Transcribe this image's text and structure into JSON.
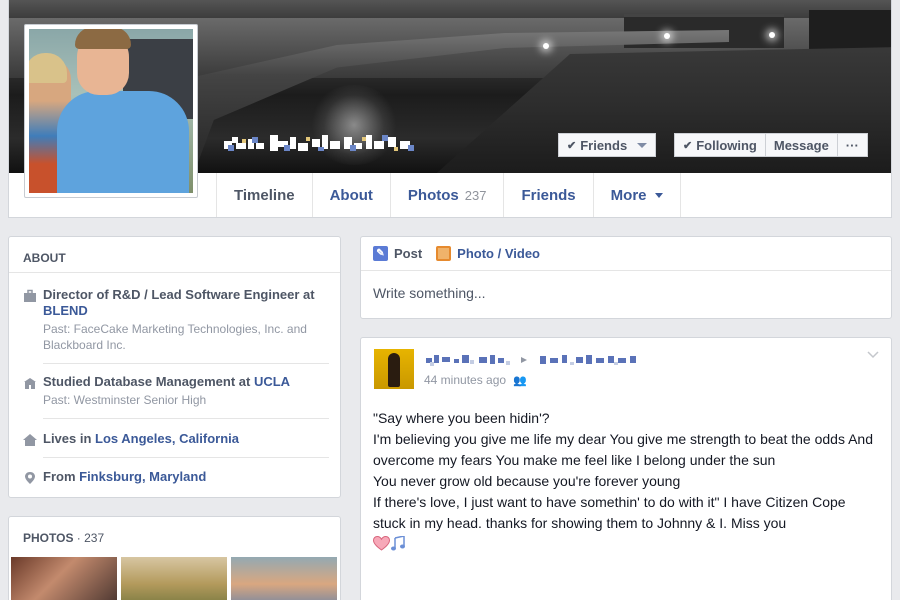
{
  "colors": {
    "link": "#3b5998",
    "muted": "#9197a3",
    "text": "#4e5665",
    "bg": "#e9eaed"
  },
  "profile": {
    "relationship_buttons": [
      {
        "label": "Friends",
        "icon": "check-icon",
        "has_caret": true
      },
      {
        "label": "Following",
        "icon": "check-icon",
        "has_caret": false
      },
      {
        "label": "Message",
        "icon": "",
        "has_caret": false
      },
      {
        "label": "···",
        "icon": "more-icon",
        "has_caret": false
      }
    ]
  },
  "tabs": [
    {
      "label": "Timeline",
      "count": "",
      "active": true
    },
    {
      "label": "About",
      "count": "",
      "active": false
    },
    {
      "label": "Photos",
      "count": "237",
      "active": false
    },
    {
      "label": "Friends",
      "count": "",
      "active": false
    },
    {
      "label": "More",
      "count": "",
      "active": false,
      "caret": true
    }
  ],
  "about": {
    "heading": "ABOUT",
    "items": [
      {
        "icon": "briefcase-icon",
        "prefix": "Director of R&D / Lead Software Engineer at ",
        "link": "BLEND",
        "mid": "",
        "link2": "",
        "sub": "Past: FaceCake Marketing Technologies, Inc. and Blackboard Inc."
      },
      {
        "icon": "school-icon",
        "prefix": "Studied Database Management at ",
        "link": "UCLA",
        "mid": "",
        "link2": "",
        "sub": "Past: Westminster Senior High"
      },
      {
        "icon": "home-icon",
        "prefix": "Lives in ",
        "link": "Los Angeles, California",
        "mid": "",
        "link2": "",
        "sub": ""
      },
      {
        "icon": "location-pin-icon",
        "prefix": "From ",
        "link": "Finksburg, Maryland",
        "mid": "",
        "link2": "",
        "sub": ""
      }
    ]
  },
  "photos": {
    "heading": "PHOTOS",
    "count": " · 237"
  },
  "composer": {
    "tabs": [
      {
        "label": "Post",
        "icon": "pencil-icon"
      },
      {
        "label": "Photo / Video",
        "icon": "photo-icon"
      }
    ],
    "placeholder": "Write something..."
  },
  "story": {
    "time": "44 minutes ago",
    "audience_icon": "friends-audience-icon",
    "lines": [
      "\"Say where you been hidin'?",
      "I'm believing you give me life my dear You give me strength to beat the odds And overcome my fears You make me feel like I belong under the sun",
      "You never grow old because you're forever young",
      "If there's love, I just want to have somethin' to do with it\" I have Citizen Cope stuck in my head. thanks for showing them to Johnny & I. Miss you"
    ],
    "emoji": [
      "heart-icon",
      "music-note-icon"
    ]
  }
}
